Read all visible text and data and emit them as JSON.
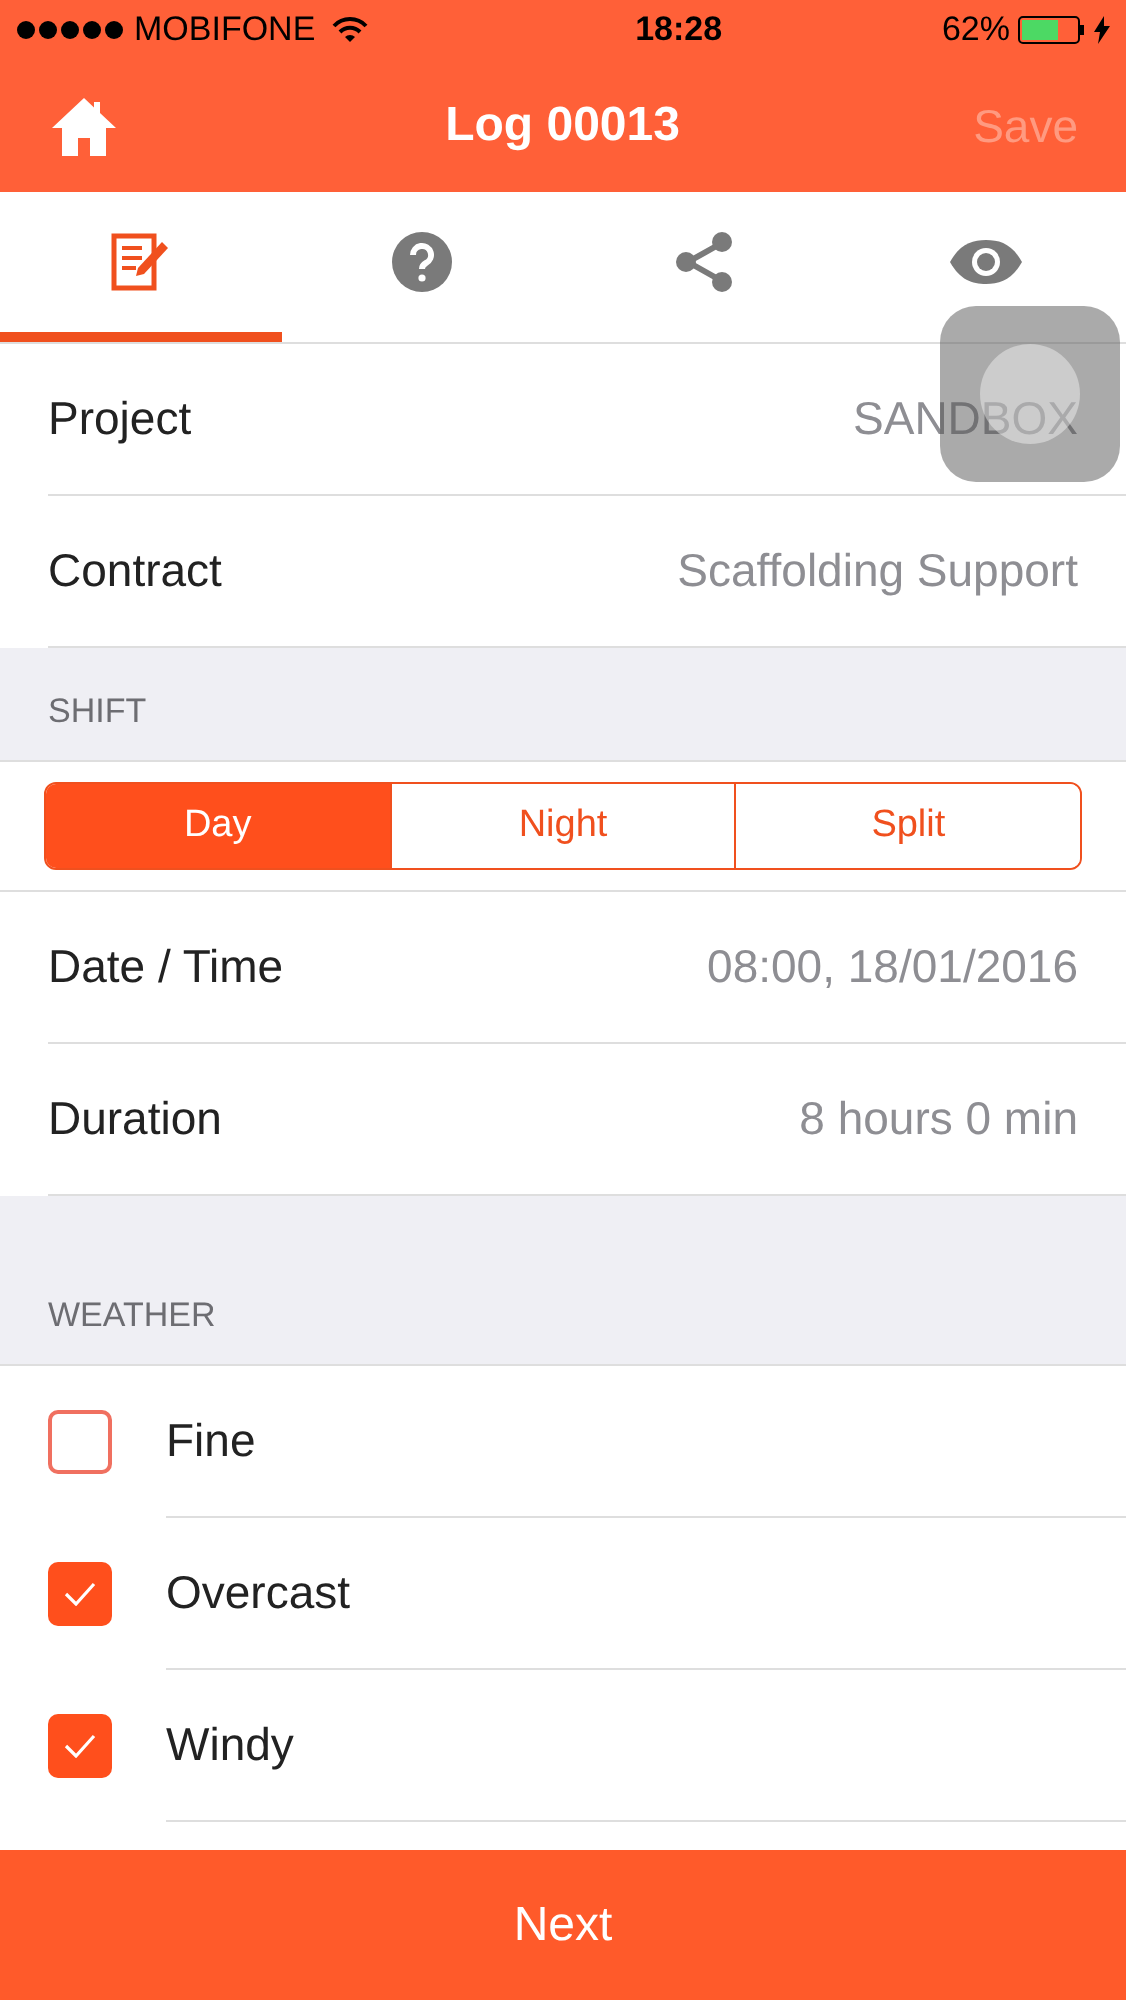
{
  "status_bar": {
    "carrier": "MOBIFONE",
    "time": "18:28",
    "battery": "62%"
  },
  "header": {
    "title": "Log 00013",
    "save": {
      "label": "Save",
      "disabled": true
    }
  },
  "tabs": [
    {
      "kind": "edit",
      "selected": true
    },
    {
      "kind": "help",
      "selected": false
    },
    {
      "kind": "share",
      "selected": false
    },
    {
      "kind": "view",
      "selected": false
    }
  ],
  "details": [
    {
      "label": "Project",
      "value": "SANDBOX"
    },
    {
      "label": "Contract",
      "value": "Scaffolding Support"
    }
  ],
  "shift": {
    "heading": "SHIFT",
    "options": [
      {
        "label": "Day",
        "selected": true
      },
      {
        "label": "Night",
        "selected": false
      },
      {
        "label": "Split",
        "selected": false
      }
    ],
    "rows": [
      {
        "label": "Date / Time",
        "value": "08:00, 18/01/2016"
      },
      {
        "label": "Duration",
        "value": "8 hours 0 min"
      }
    ]
  },
  "weather": {
    "heading": "WEATHER",
    "items": [
      {
        "label": "Fine",
        "checked": false
      },
      {
        "label": "Overcast",
        "checked": true
      },
      {
        "label": "Windy",
        "checked": true
      }
    ]
  },
  "next_button": "Next"
}
